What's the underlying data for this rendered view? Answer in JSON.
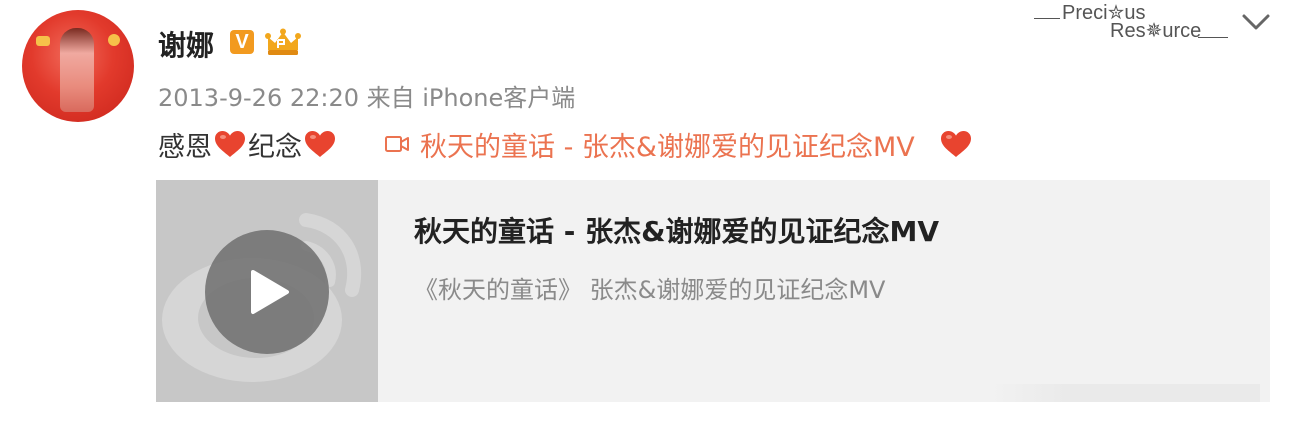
{
  "user": {
    "name": "谢娜",
    "verified_badge": "V"
  },
  "post": {
    "meta": "2013-9-26 22:20 来自 iPhone客户端",
    "text_part1": "感恩",
    "text_part2": "纪念",
    "link_label": "秋天的童话 - 张杰&谢娜爱的见证纪念MV"
  },
  "card": {
    "title": "秋天的童话 - 张杰&谢娜爱的见证纪念MV",
    "subtitle": "《秋天的童话》 张杰&谢娜爱的见证纪念MV"
  },
  "watermark": {
    "line1": "Preci✮us",
    "line2": "Res✵urce"
  },
  "colors": {
    "link": "#eb7350",
    "heart": "#e8442f",
    "badge": "#f29a1f"
  },
  "icons": {
    "heart": "heart-icon",
    "video": "video-icon",
    "play": "play-icon",
    "menu": "chevron-down-icon"
  }
}
